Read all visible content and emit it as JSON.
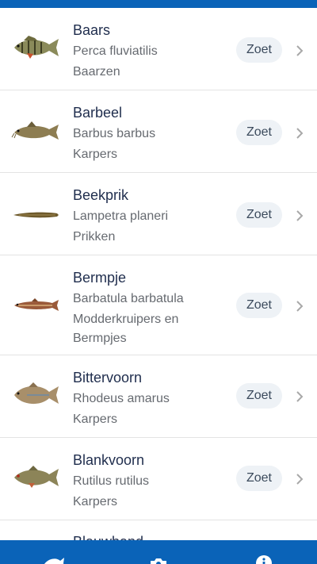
{
  "species": [
    {
      "name": "Baars",
      "scientific": "Perca fluviatilis",
      "family": "Baarzen",
      "water": "Zoet",
      "icon": "perch-fish-icon"
    },
    {
      "name": "Barbeel",
      "scientific": "Barbus barbus",
      "family": "Karpers",
      "water": "Zoet",
      "icon": "barbel-fish-icon"
    },
    {
      "name": "Beekprik",
      "scientific": "Lampetra planeri",
      "family": "Prikken",
      "water": "Zoet",
      "icon": "lamprey-fish-icon"
    },
    {
      "name": "Bermpje",
      "scientific": "Barbatula barbatula",
      "family": "Modderkruipers en Bermpjes",
      "water": "Zoet",
      "icon": "loach-fish-icon"
    },
    {
      "name": "Bittervoorn",
      "scientific": "Rhodeus amarus",
      "family": "Karpers",
      "water": "Zoet",
      "icon": "bitterling-fish-icon"
    },
    {
      "name": "Blankvoorn",
      "scientific": "Rutilus rutilus",
      "family": "Karpers",
      "water": "Zoet",
      "icon": "roach-fish-icon"
    },
    {
      "name": "Blauwband",
      "scientific": "",
      "family": "",
      "water": "",
      "icon": "fish-icon"
    }
  ],
  "bottom_nav": {
    "items": [
      {
        "icon": "fish-icon"
      },
      {
        "icon": "camera-icon"
      },
      {
        "icon": "info-icon"
      }
    ]
  },
  "colors": {
    "header": "#0a63b8",
    "badge_bg": "#eef2f6",
    "name": "#1f2d4d",
    "secondary": "#666a70"
  }
}
